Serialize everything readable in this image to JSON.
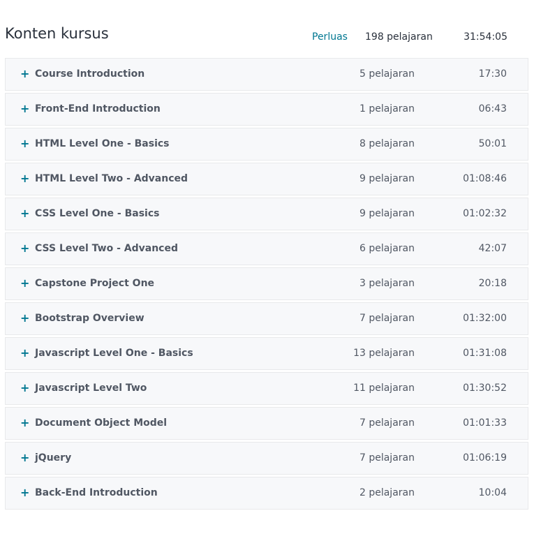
{
  "header": {
    "title": "Konten kursus",
    "expand_label": "Perluas",
    "total_lessons": "198 pelajaran",
    "total_duration": "31:54:05"
  },
  "sections": [
    {
      "title": "Course Introduction",
      "lessons": "5 pelajaran",
      "duration": "17:30"
    },
    {
      "title": "Front-End Introduction",
      "lessons": "1 pelajaran",
      "duration": "06:43"
    },
    {
      "title": "HTML Level One - Basics",
      "lessons": "8 pelajaran",
      "duration": "50:01"
    },
    {
      "title": "HTML Level Two - Advanced",
      "lessons": "9 pelajaran",
      "duration": "01:08:46"
    },
    {
      "title": "CSS Level One - Basics",
      "lessons": "9 pelajaran",
      "duration": "01:02:32"
    },
    {
      "title": "CSS Level Two - Advanced",
      "lessons": "6 pelajaran",
      "duration": "42:07"
    },
    {
      "title": "Capstone Project One",
      "lessons": "3 pelajaran",
      "duration": "20:18"
    },
    {
      "title": "Bootstrap Overview",
      "lessons": "7 pelajaran",
      "duration": "01:32:00"
    },
    {
      "title": "Javascript Level One - Basics",
      "lessons": "13 pelajaran",
      "duration": "01:31:08"
    },
    {
      "title": "Javascript Level Two",
      "lessons": "11 pelajaran",
      "duration": "01:30:52"
    },
    {
      "title": "Document Object Model",
      "lessons": "7 pelajaran",
      "duration": "01:01:33"
    },
    {
      "title": "jQuery",
      "lessons": "7 pelajaran",
      "duration": "01:06:19"
    },
    {
      "title": "Back-End Introduction",
      "lessons": "2 pelajaran",
      "duration": "10:04"
    }
  ],
  "icons": {
    "expand_icon": "plus-icon",
    "expand_glyph": "+"
  },
  "colors": {
    "accent": "#007791",
    "text": "#29303b",
    "section_background": "#f7f8fa",
    "section_border": "#e8e9eb"
  }
}
